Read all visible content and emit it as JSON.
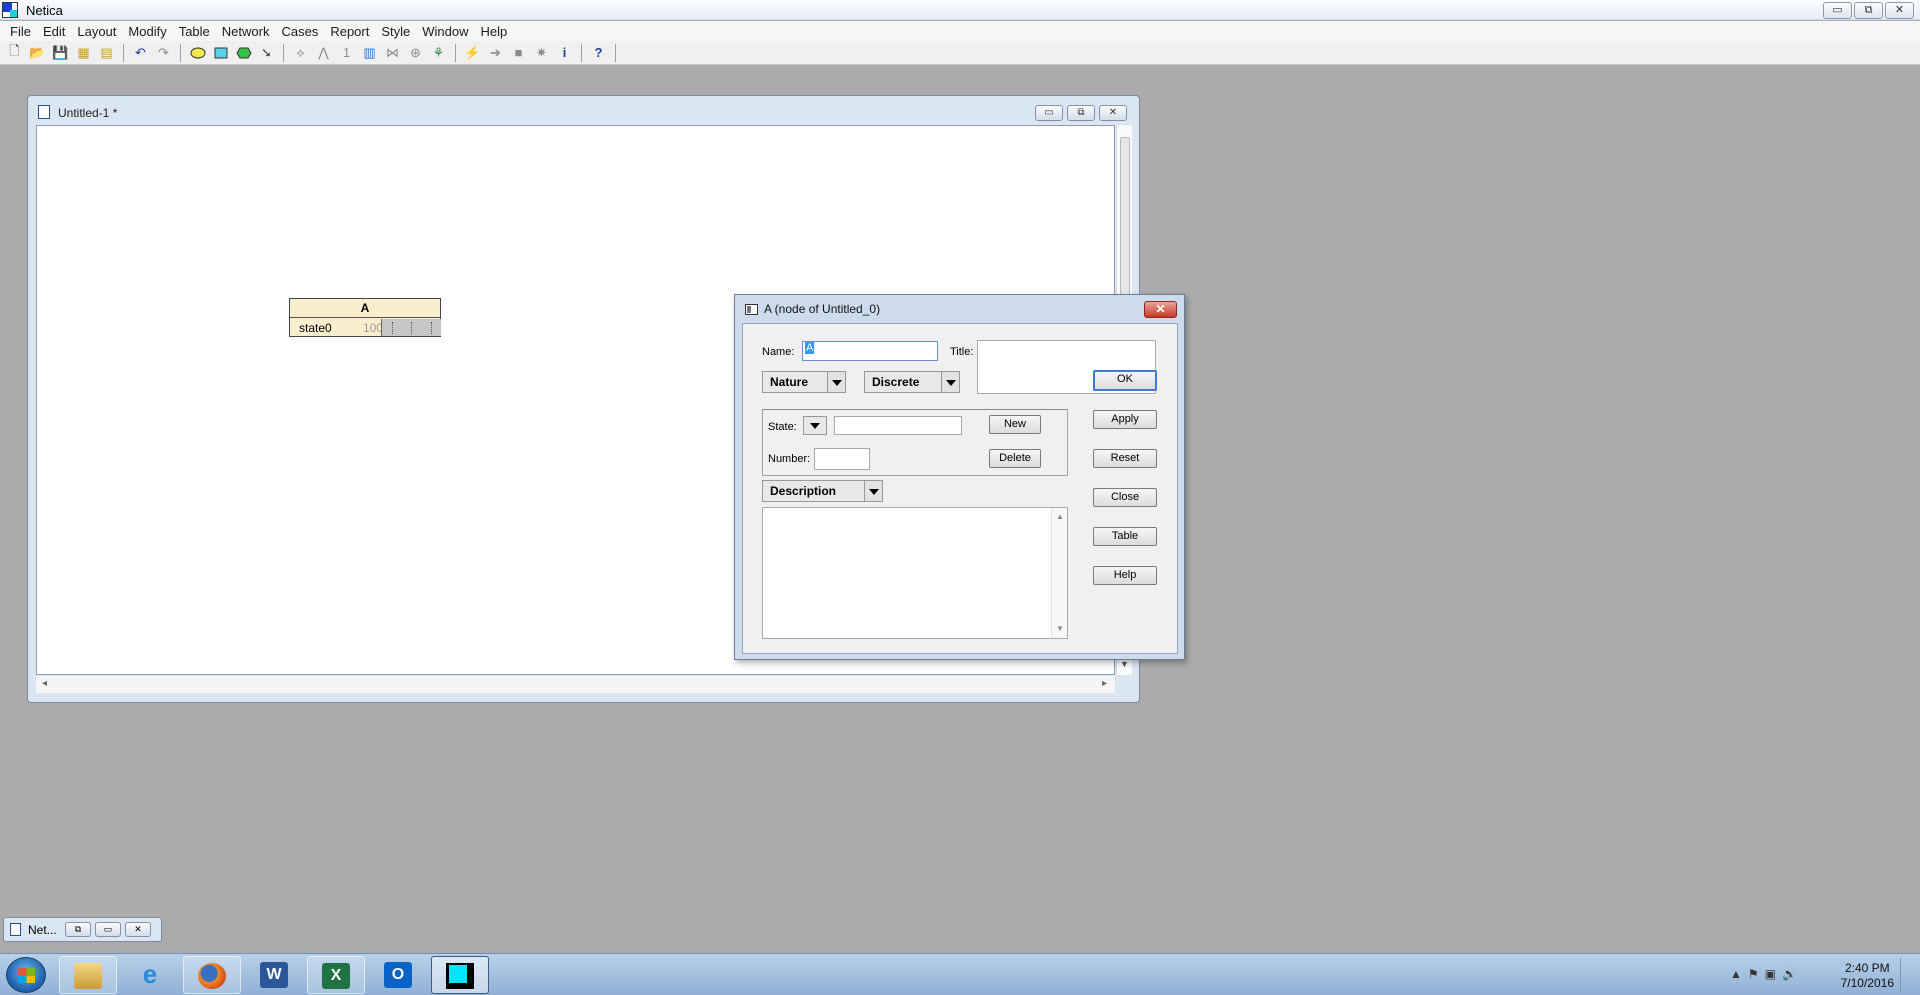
{
  "app": {
    "title": "Netica"
  },
  "window_controls": {
    "minimize": "▭",
    "restore": "⧉",
    "close": "✕"
  },
  "menu": [
    "File",
    "Edit",
    "Layout",
    "Modify",
    "Table",
    "Network",
    "Cases",
    "Report",
    "Style",
    "Window",
    "Help"
  ],
  "toolbar_icons": [
    "new-icon",
    "open-icon",
    "save-icon",
    "save-all-icon",
    "print-icon",
    "undo-icon",
    "redo-icon",
    "ellipse-node-icon",
    "rectangle-node-icon",
    "hexagon-node-icon",
    "pointer-icon",
    "compile-icon",
    "absorb-icon",
    "number-icon",
    "chart-icon",
    "shrink-icon",
    "find-icon",
    "link-icon",
    "flash-icon",
    "arrow-icon",
    "decision-icon",
    "star-icon",
    "info-icon",
    "help-icon"
  ],
  "doc_window": {
    "title": "Untitled-1 *",
    "node": {
      "name": "A",
      "state": "state0",
      "value": "100"
    }
  },
  "dialog": {
    "title": "A (node of Untitled_0)",
    "close": "✕",
    "name_label": "Name:",
    "name_value": "A",
    "title_label": "Title:",
    "title_value": "",
    "nature": "Nature",
    "discrete": "Discrete",
    "state_label": "State:",
    "state_value": "",
    "number_label": "Number:",
    "number_value": "",
    "new_btn": "New",
    "delete_btn": "Delete",
    "description": "Description",
    "description_text": "",
    "buttons": {
      "ok": "OK",
      "apply": "Apply",
      "reset": "Reset",
      "close": "Close",
      "table": "Table",
      "help": "Help"
    }
  },
  "minimized": {
    "title": "Net..."
  },
  "taskbar": {
    "apps": [
      "windows-explorer",
      "internet-explorer",
      "firefox",
      "word",
      "excel",
      "outlook",
      "netica"
    ],
    "icon_labels": {
      "word": "W",
      "excel": "X",
      "outlook": "O"
    },
    "time": "2:40 PM",
    "date": "7/10/2016"
  }
}
